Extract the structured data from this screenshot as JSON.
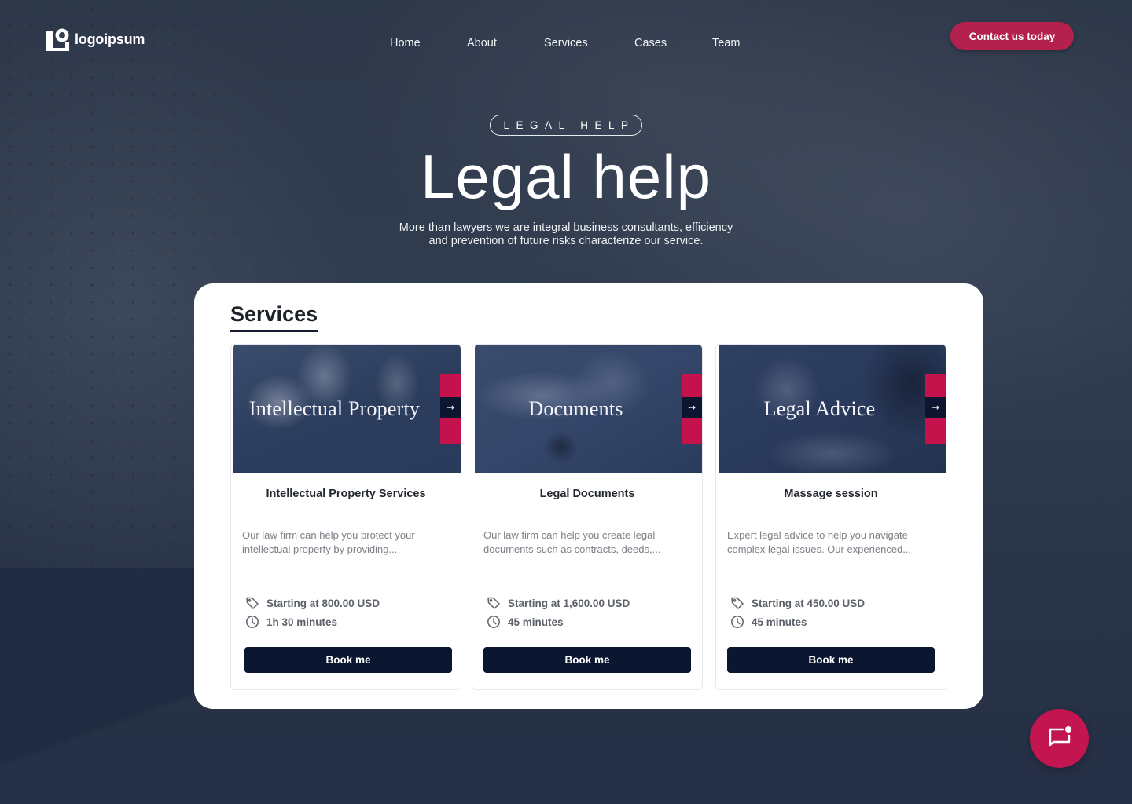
{
  "brand": {
    "name": "logoipsum",
    "logo_icon": "logo-mark-icon",
    "accent_color": "#c3124c",
    "navy_color": "#0b1630"
  },
  "nav": {
    "items": [
      {
        "label": "Home"
      },
      {
        "label": "About"
      },
      {
        "label": "Services"
      },
      {
        "label": "Cases"
      },
      {
        "label": "Team"
      }
    ],
    "cta_label": "Contact us today"
  },
  "hero": {
    "eyebrow": "LEGAL HELP",
    "title": "Legal help",
    "subtitle_line1": "More than lawyers we are integral business consultants, efficiency",
    "subtitle_line2": "and prevention of future risks characterize our service."
  },
  "services": {
    "title": "Services",
    "cards": [
      {
        "image_title": "Intellectual Property",
        "arrow_icon": "arrow-right-icon",
        "heading": "Intellectual Property Services",
        "description": "Our law firm can help you protect your intellectual property by providing...",
        "price": "Starting at 800.00 USD",
        "duration": "1h 30 minutes",
        "button_label": "Book me"
      },
      {
        "image_title": "Documents",
        "arrow_icon": "arrow-right-icon",
        "heading": "Legal Documents",
        "description": "Our law firm can help you create legal documents such as contracts, deeds,...",
        "price": "Starting at 1,600.00 USD",
        "duration": "45 minutes",
        "button_label": "Book me"
      },
      {
        "image_title": "Legal Advice",
        "arrow_icon": "arrow-right-icon",
        "heading": "Massage session",
        "description": "Expert legal advice to help you navigate complex legal issues. Our experienced...",
        "price": "Starting at 450.00 USD",
        "duration": "45 minutes",
        "button_label": "Book me"
      }
    ]
  },
  "chat": {
    "icon": "chat-notification-icon"
  },
  "glyphs": {
    "arrow": "→"
  }
}
